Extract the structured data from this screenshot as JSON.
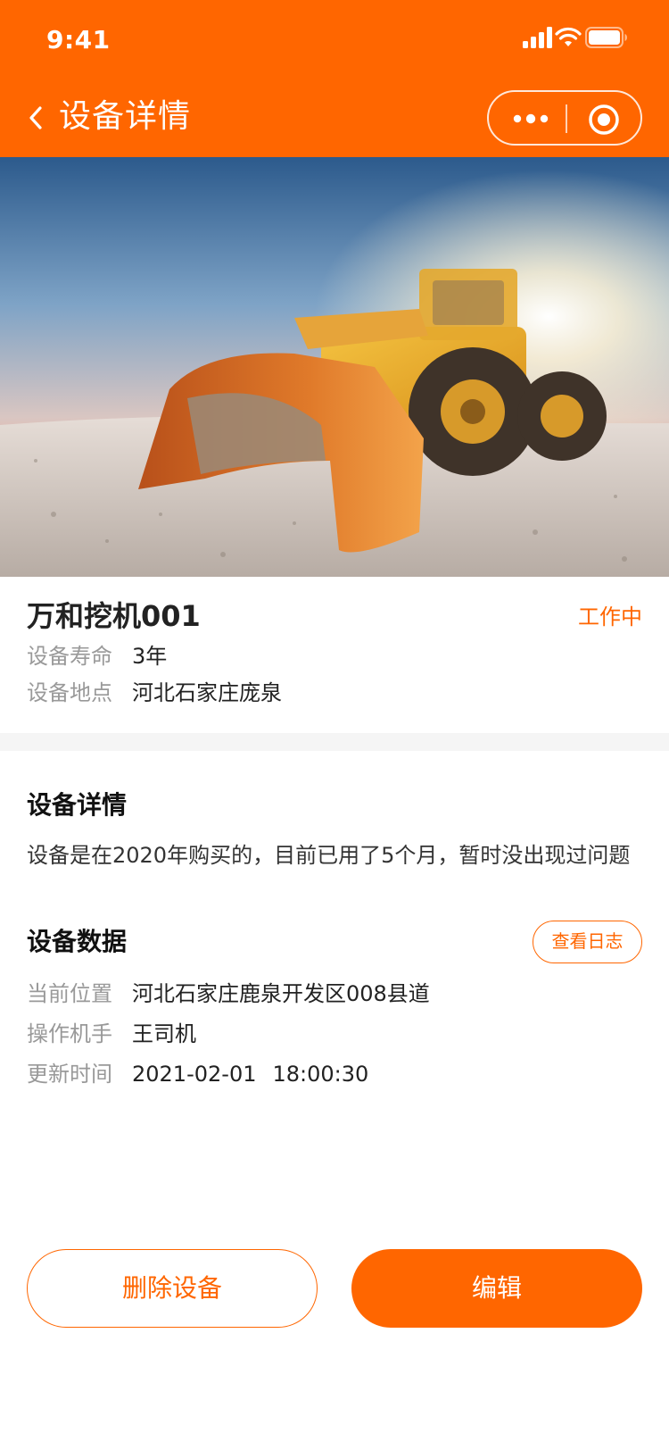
{
  "status_bar": {
    "time": "9:41"
  },
  "nav": {
    "title": "设备详情"
  },
  "device": {
    "name": "万和挖机001",
    "status": "工作中",
    "lifespan_label": "设备寿命",
    "lifespan_value": "3年",
    "location_label": "设备地点",
    "location_value": "河北石家庄庞泉"
  },
  "detail": {
    "title": "设备详情",
    "text": "设备是在2020年购买的，目前已用了5个月，暂时没出现过问题"
  },
  "data_section": {
    "title": "设备数据",
    "log_button": "查看日志",
    "current_position_label": "当前位置",
    "current_position_value": "河北石家庄鹿泉开发区008县道",
    "operator_label": "操作机手",
    "operator_value": "王司机",
    "updated_label": "更新时间",
    "updated_date": "2021-02-01",
    "updated_time": "18:00:30"
  },
  "actions": {
    "delete_label": "删除设备",
    "edit_label": "编辑"
  },
  "colors": {
    "accent": "#ff6600",
    "label_gray": "#999999",
    "section_bg": "#f5f5f5"
  },
  "icons": {
    "back": "chevron-left-icon",
    "more": "more-dots-icon",
    "target": "target-circle-icon",
    "signal": "cellular-signal-icon",
    "wifi": "wifi-icon",
    "battery": "battery-icon"
  }
}
